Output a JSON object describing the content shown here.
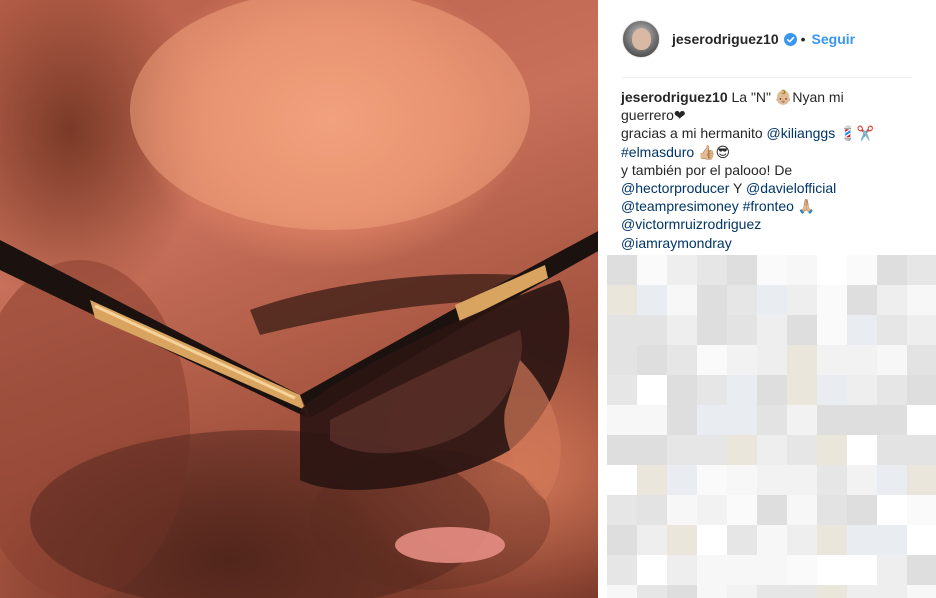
{
  "post": {
    "username": "jeserodriguez10",
    "verified": true,
    "separator": "•",
    "follow_label": "Seguir"
  },
  "caption": {
    "username": "jeserodriguez10",
    "lines": [
      [
        {
          "t": "La \"N\" 👶🏼Nyan mi",
          "k": "text"
        }
      ],
      [
        {
          "t": "guerrero❤",
          "k": "text"
        }
      ],
      [
        {
          "t": "gracias a mi hermanito ",
          "k": "text"
        },
        {
          "t": "@kilianggs",
          "k": "link"
        },
        {
          "t": " 💈✂️",
          "k": "text"
        }
      ],
      [
        {
          "t": "#elmasduro",
          "k": "link"
        },
        {
          "t": " 👍🏼😎",
          "k": "text"
        }
      ],
      [
        {
          "t": "y también por el palooo! De",
          "k": "text"
        }
      ],
      [
        {
          "t": "@hectorproducer",
          "k": "link"
        },
        {
          "t": " Y ",
          "k": "text"
        },
        {
          "t": "@davielofficial",
          "k": "link"
        }
      ],
      [
        {
          "t": "@teampresimoney",
          "k": "link"
        },
        {
          "t": " ",
          "k": "text"
        },
        {
          "t": "#fronteo",
          "k": "link"
        },
        {
          "t": " 🙏🏼",
          "k": "text"
        }
      ],
      [
        {
          "t": "@victormruizrodriguez",
          "k": "link"
        }
      ],
      [
        {
          "t": "@iamraymondray",
          "k": "link"
        }
      ]
    ]
  },
  "colors": {
    "follow": "#3897f0",
    "link": "#003569",
    "verified": "#3897f0",
    "divider": "#efefef"
  },
  "icons": {
    "verified": "verified-badge-icon"
  }
}
